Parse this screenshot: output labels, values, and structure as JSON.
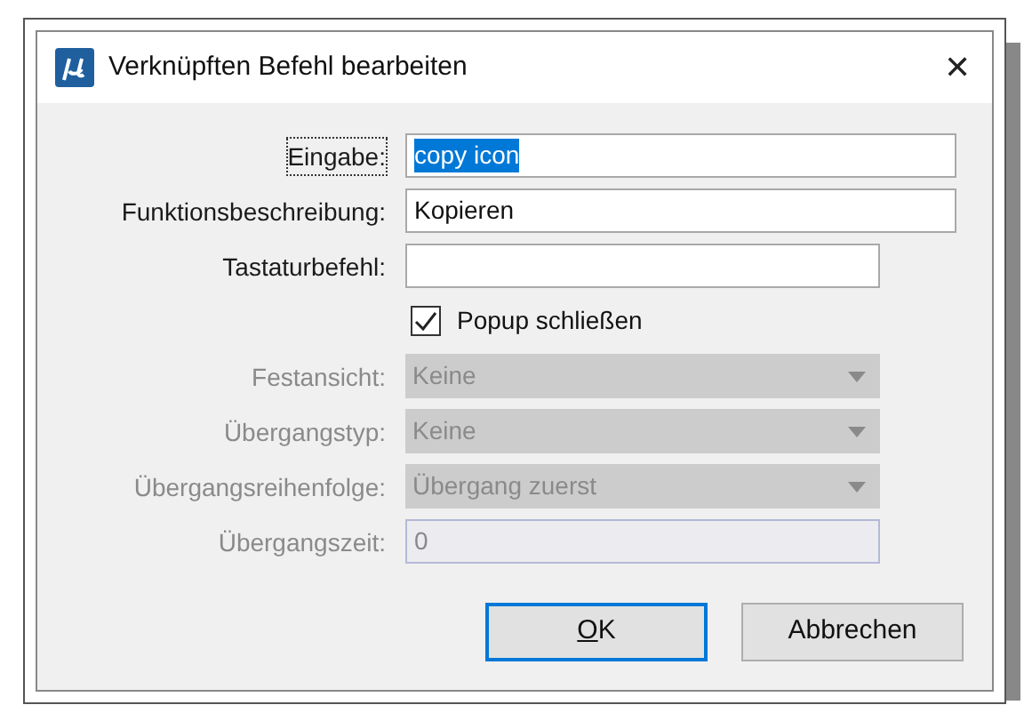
{
  "window": {
    "title": "Verknüpften Befehl bearbeiten",
    "close": "✕"
  },
  "fields": [
    {
      "kind": "text",
      "label": "Eingabe:",
      "value": "copy icon",
      "disabled": false,
      "focused": true,
      "wide": true
    },
    {
      "kind": "text",
      "label": "Funktionsbeschreibung:",
      "value": "Kopieren",
      "disabled": false,
      "focused": false,
      "wide": true
    },
    {
      "kind": "text",
      "label": "Tastaturbefehl:",
      "disabled": false,
      "focused": false,
      "wide": false
    },
    {
      "kind": "checkbox",
      "label": "Popup schließen",
      "checked": true,
      "disabled": false
    },
    {
      "kind": "combo",
      "label": "Festansicht:",
      "value": "Keine",
      "disabled": true,
      "wide": false
    },
    {
      "kind": "combo",
      "label": "Übergangstyp:",
      "value": "Keine",
      "disabled": true,
      "wide": false
    },
    {
      "kind": "combo",
      "label": "Übergangsreihenfolge:",
      "value": "Übergang zuerst",
      "disabled": true,
      "wide": false
    },
    {
      "kind": "text",
      "label": "Übergangszeit:",
      "value": "0",
      "disabled": true,
      "focused": false,
      "wide": false
    }
  ],
  "buttons": [
    {
      "label": "OK",
      "default": true
    },
    {
      "label": "Abbrechen",
      "default": false
    }
  ]
}
